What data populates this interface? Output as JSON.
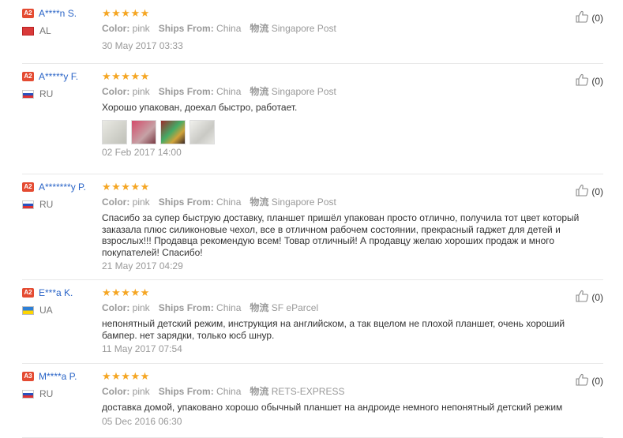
{
  "labels": {
    "color": "Color:",
    "ships_from": "Ships From:",
    "logistics": "物流"
  },
  "colors": {
    "star": "#f5a623",
    "name": "#2b65c7",
    "level_badge": "#e44b32"
  },
  "icons": {
    "like": "thumbs-up-icon",
    "rating": "star-icon"
  },
  "reviews": [
    {
      "level": "A2",
      "name": "A****n S.",
      "flag": "flag-al",
      "country": "AL",
      "rating": 5,
      "stars": "★★★★★",
      "color": "pink",
      "ships_from": "China",
      "shipping": "Singapore Post",
      "text": "",
      "photos": 0,
      "date": "30 May 2017 03:33",
      "likes": "(0)"
    },
    {
      "level": "A2",
      "name": "A*****y F.",
      "flag": "flag-ru",
      "country": "RU",
      "rating": 5,
      "stars": "★★★★★",
      "color": "pink",
      "ships_from": "China",
      "shipping": "Singapore Post",
      "text": "Хорошо упакован, доехал быстро, работает.",
      "photos": 4,
      "date": "02 Feb 2017 14:00",
      "likes": "(0)"
    },
    {
      "level": "A2",
      "name": "A*******y P.",
      "flag": "flag-ru",
      "country": "RU",
      "rating": 5,
      "stars": "★★★★★",
      "color": "pink",
      "ships_from": "China",
      "shipping": "Singapore Post",
      "text": "Спасибо за супер быструю доставку, планшет пришёл упакован просто отлично, получила тот цвет который заказала плюс силиконовые чехол, все в отличном рабочем состоянии, прекрасный гаджет для детей и взрослых!!! Продавца рекомендую всем! Товар отличный! А продавцу желаю хороших продаж и много покупателей! Спасибо!",
      "photos": 0,
      "date": "21 May 2017 04:29",
      "likes": "(0)"
    },
    {
      "level": "A2",
      "name": "E***a K.",
      "flag": "flag-ua",
      "country": "UA",
      "rating": 5,
      "stars": "★★★★★",
      "color": "pink",
      "ships_from": "China",
      "shipping": "SF eParcel",
      "text": "непонятный детский режим, инструкция на английском, а так вцелом не плохой планшет, очень хороший бампер. нет зарядки, только юсб шнур.",
      "photos": 0,
      "date": "11 May 2017 07:54",
      "likes": "(0)"
    },
    {
      "level": "A3",
      "name": "M****a P.",
      "flag": "flag-ru",
      "country": "RU",
      "rating": 5,
      "stars": "★★★★★",
      "color": "pink",
      "ships_from": "China",
      "shipping": "RETS-EXPRESS",
      "text": "доставка домой, упаковано хорошо обычный планшет на андроиде немного непонятный детский режим",
      "photos": 0,
      "date": "05 Dec 2016 06:30",
      "likes": "(0)"
    }
  ]
}
